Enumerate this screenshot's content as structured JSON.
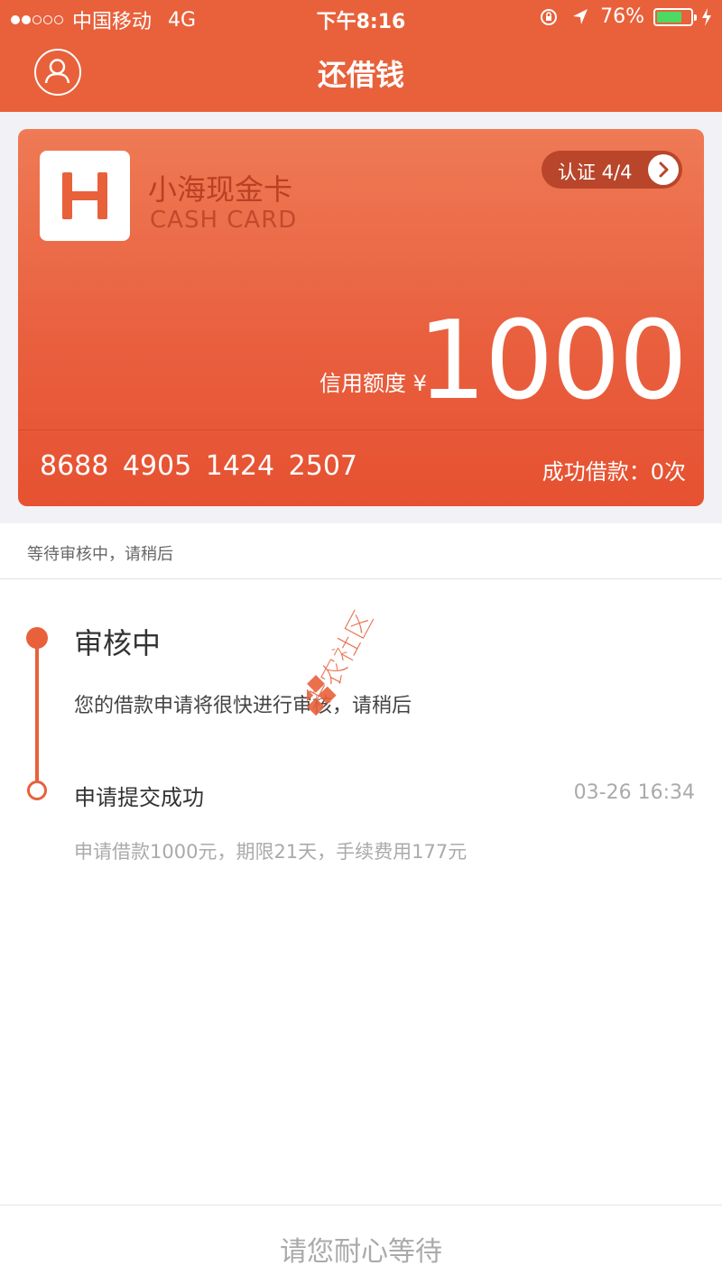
{
  "status_bar": {
    "carrier": "中国移动",
    "network": "4G",
    "time": "下午8:16",
    "battery": "76%",
    "battery_level": 0.76
  },
  "nav": {
    "title": "还借钱",
    "profile_icon": "user-profile-icon"
  },
  "card": {
    "logo_letter": "H",
    "name": "小海现金卡",
    "subtitle": "CASH CARD",
    "verify_label": "认证 4/4",
    "limit_label": "信用额度 ¥",
    "limit_value": "1000",
    "number": "8688  4905  1424  2507",
    "success_count": "成功借款：0次",
    "colors": {
      "accent": "#e8613b",
      "card_top": "#ef7a55",
      "card_bottom": "#e65131"
    }
  },
  "notice": "等待审核中，请稍后",
  "timeline": {
    "step1_title": "审核中",
    "step1_desc": "您的借款申请将很快进行审核，请稍后",
    "step2_title": "申请提交成功",
    "step2_time": "03-26 16:34",
    "step2_desc": "申请借款1000元，期限21天，手续费用177元"
  },
  "watermark": "卡农社区",
  "footer": "请您耐心等待"
}
